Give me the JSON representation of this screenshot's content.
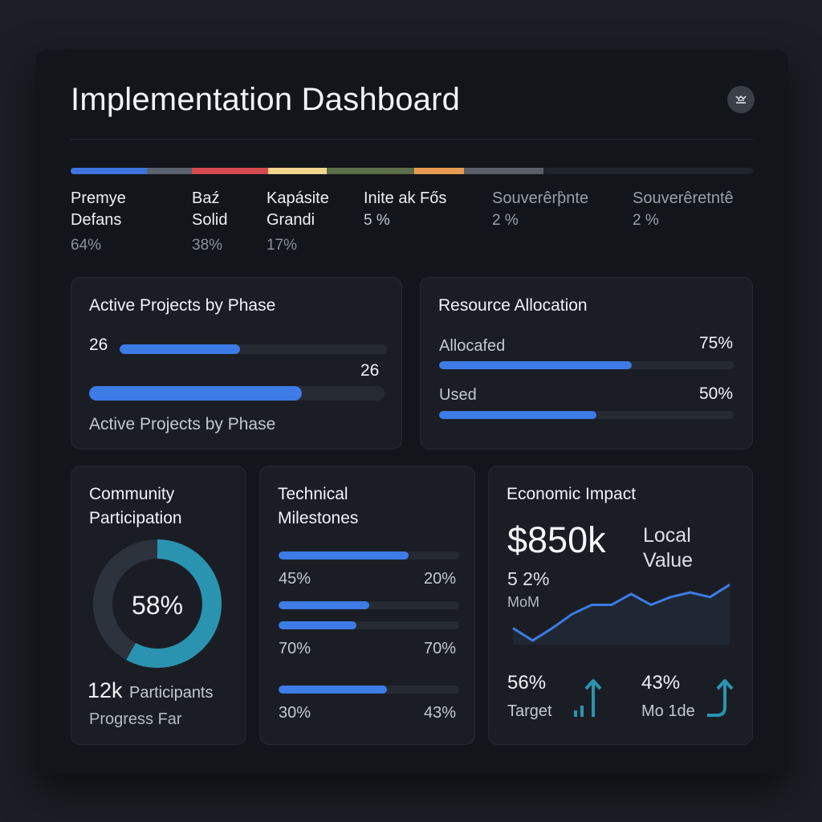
{
  "title": "Implementation Dashboard",
  "colors": {
    "background": "#1b1e24",
    "panel": "#121519",
    "card": "#1a1e24",
    "accent_blue": "#3d7be6",
    "accent_teal": "#2a93b0",
    "track": "#262b33"
  },
  "avatar_icon": "user-avatar-icon",
  "segments": [
    {
      "color": "#3f74de",
      "fraction": 0.112
    },
    {
      "color": "#5b6270",
      "fraction": 0.066
    },
    {
      "color": "#d44a4f",
      "fraction": 0.111
    },
    {
      "color": "#f1d58b",
      "fraction": 0.086
    },
    {
      "color": "#5d6e4a",
      "fraction": 0.129
    },
    {
      "color": "#e79a52",
      "fraction": 0.073
    },
    {
      "color": "#5a5f68",
      "fraction": 0.116
    }
  ],
  "legend": [
    {
      "name": "Premye\nDefans",
      "pct": "64%"
    },
    {
      "name": "Baź\nSolid",
      "pct": "38%"
    },
    {
      "name": "Kapásite\nGrandi",
      "pct": "17%"
    },
    {
      "name": "Inite ak Fős",
      "pct": "5 %"
    },
    {
      "name": "Souverêrþ̀nte",
      "pct": "2 %"
    },
    {
      "name": "Souverêretntê",
      "pct": "2 %"
    }
  ],
  "active_projects": {
    "title": "Active Projects by Phase",
    "bar1": {
      "value": "26",
      "fraction": 0.45
    },
    "bar2": {
      "value": "26",
      "fraction": 0.72
    },
    "footer": "Active Projects by Phase"
  },
  "resource_allocation": {
    "title": "Resource Allocation",
    "rows": [
      {
        "label": "Allocafed",
        "value": "75%",
        "fraction": 0.655
      },
      {
        "label": "Used",
        "value": "50%",
        "fraction": 0.535
      }
    ]
  },
  "community": {
    "title": "Community\nParticipation",
    "donut_value": "58%",
    "donut_fraction": 0.58,
    "count": "12k",
    "count_label": "Participants",
    "footer": "Progress Far"
  },
  "milestones": {
    "title": "Technical\nMilestones",
    "bar_fractions": [
      0.72,
      0.5,
      0.43,
      0.6
    ],
    "labels": [
      {
        "left": "45%",
        "right": "20%"
      },
      {
        "left": "70%",
        "right": "70%"
      },
      {
        "left": "30%",
        "right": "43%"
      }
    ]
  },
  "economic": {
    "title": "Economic Impact",
    "big_value": "$850k",
    "side_label": "Local\nValue",
    "change": "5 2%",
    "change_label": "MoM",
    "sparkline": [
      62,
      54,
      62,
      71,
      77,
      77,
      84,
      77,
      82,
      85,
      82,
      90
    ],
    "stats": [
      {
        "value": "56%",
        "label": "Target",
        "icon": "bar-chart-arrow-up-icon"
      },
      {
        "value": "43%",
        "label": "Mo 1de",
        "icon": "curved-arrow-up-icon"
      }
    ]
  }
}
